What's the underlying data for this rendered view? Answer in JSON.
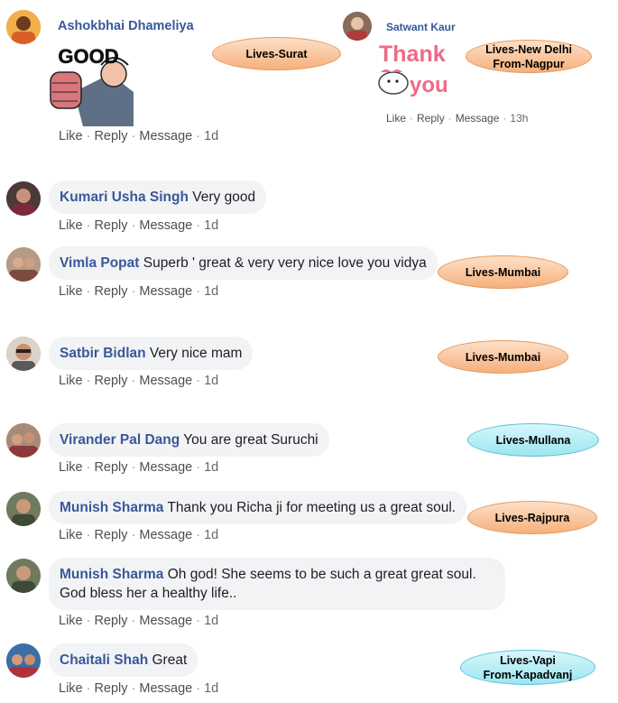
{
  "actions": {
    "like": "Like",
    "reply": "Reply",
    "message": "Message"
  },
  "colors": {
    "name": "#385898",
    "bubble": "#f2f3f5",
    "tag_orange": "#f6b07c",
    "tag_blue": "#9be6f1"
  },
  "comments": [
    {
      "name": "Ashokbhai Dhameliya",
      "text": "",
      "sticker": "good-sticker",
      "sticker_text": "GOOD",
      "time": "1d"
    },
    {
      "name": "Satwant Kaur",
      "text": "",
      "sticker": "thank-you-sticker",
      "sticker_line1": "Thank",
      "sticker_line2": "you",
      "time": "13h"
    },
    {
      "name": "Kumari Usha Singh",
      "text": "Very good",
      "time": "1d"
    },
    {
      "name": "Vimla Popat",
      "text": "Superb ' great & very very nice love you vidya",
      "time": "1d"
    },
    {
      "name": "Satbir Bidlan",
      "text": "Very nice mam",
      "time": "1d"
    },
    {
      "name": "Virander Pal Dang",
      "text": "You are great Suruchi",
      "time": "1d"
    },
    {
      "name": "Munish Sharma",
      "text": "Thank you Richa ji for meeting us a great soul.",
      "time": "1d"
    },
    {
      "name": "Munish Sharma",
      "text": "Oh god! She seems to be such a great great soul. God bless her a healthy life..",
      "time": "1d"
    },
    {
      "name": "Chaitali Shah",
      "text": "Great",
      "time": "1d"
    }
  ],
  "tags": [
    {
      "line1": "Lives-Surat",
      "line2": ""
    },
    {
      "line1": "Lives-New Delhi",
      "line2": "From-Nagpur"
    },
    {
      "line1": "Lives-Mumbai",
      "line2": ""
    },
    {
      "line1": "Lives-Mumbai",
      "line2": ""
    },
    {
      "line1": "Lives-Mullana",
      "line2": ""
    },
    {
      "line1": "Lives-Rajpura",
      "line2": ""
    },
    {
      "line1": "Lives-Vapi",
      "line2": "From-Kapadvanj"
    }
  ]
}
